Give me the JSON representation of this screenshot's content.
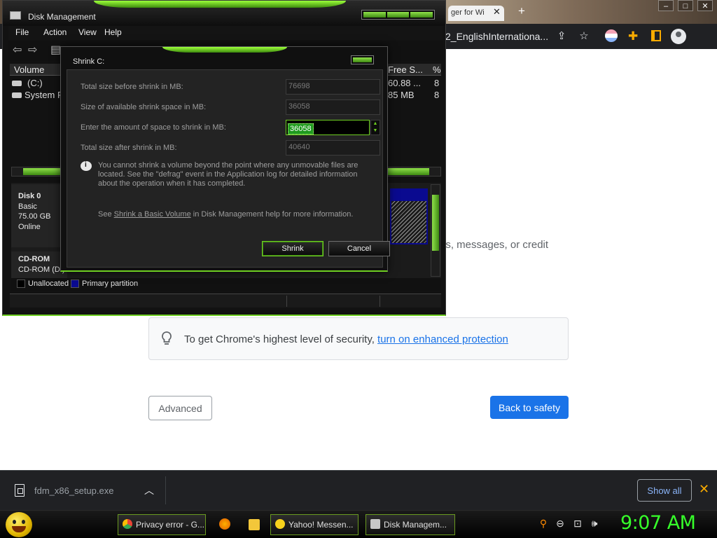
{
  "chrome": {
    "tab_title": "ger for Wi",
    "omnibox_text": "2_EnglishInternationa...",
    "hidden_text": "ds, messages, or credit",
    "security_text": "To get Chrome's highest level of security, ",
    "security_link": "turn on enhanced protection",
    "advanced_label": "Advanced",
    "back_label": "Back to safety"
  },
  "download": {
    "filename": "fdm_x86_setup.exe",
    "show_all": "Show all"
  },
  "taskbar": {
    "tasks": [
      "Privacy error - G...",
      "Yahoo! Messen...",
      "Disk Managem..."
    ],
    "clock": "9:07 AM"
  },
  "disk_mgmt": {
    "title": "Disk Management",
    "menu": [
      "File",
      "Action",
      "View",
      "Help"
    ],
    "columns": [
      "Volume",
      "Free S...",
      "%"
    ],
    "volumes": [
      {
        "name": "(C:)",
        "free": "60.88 ...",
        "pct": "8"
      },
      {
        "name": "System R",
        "free": "85 MB",
        "pct": "8"
      }
    ],
    "disk0": {
      "name": "Disk 0",
      "type": "Basic",
      "size": "75.00 GB",
      "status": "Online"
    },
    "cdrom": {
      "name": "CD-ROM",
      "label": "CD-ROM (D:)"
    },
    "legend": [
      "Unallocated",
      "Primary partition"
    ]
  },
  "shrink": {
    "title": "Shrink C:",
    "fields": [
      {
        "label": "Total size before shrink in MB:",
        "value": "76698"
      },
      {
        "label": "Size of available shrink space in MB:",
        "value": "36058"
      },
      {
        "label": "Enter the amount of space to shrink in MB:",
        "value": "36058"
      },
      {
        "label": "Total size after shrink in MB:",
        "value": "40640"
      }
    ],
    "info": "You cannot shrink a volume beyond the point where any unmovable files are located. See the \"defrag\" event in the Application log for detailed information about the operation when it has completed.",
    "help_prefix": "See ",
    "help_link": "Shrink a Basic Volume",
    "help_suffix": " in Disk Management help for more information.",
    "shrink_label": "Shrink",
    "cancel_label": "Cancel"
  },
  "colors": {
    "accent_green": "#6fcf22",
    "chrome_blue": "#1a73e8"
  }
}
